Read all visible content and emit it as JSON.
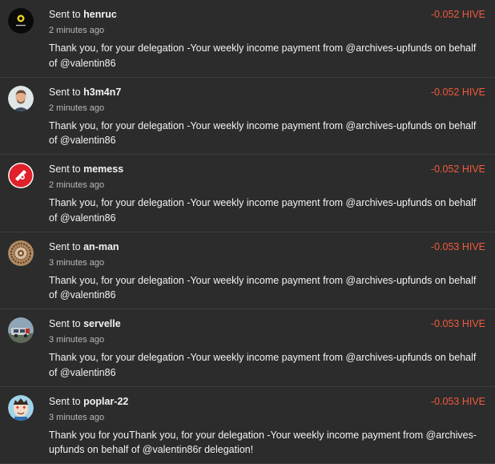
{
  "sent_prefix": "Sent to",
  "transactions": [
    {
      "user": "henruc",
      "time": "2 minutes ago",
      "amount": "-0.052 HIVE",
      "memo": "Thank you, for your delegation -Your weekly income payment from @archives-upfunds on behalf of @valentin86",
      "avatar": "black-circle-yellow-logo-avatar"
    },
    {
      "user": "h3m4n7",
      "time": "2 minutes ago",
      "amount": "-0.052 HIVE",
      "memo": "Thank you, for your delegation -Your weekly income payment from @archives-upfunds on behalf of @valentin86",
      "avatar": "man-portrait-avatar"
    },
    {
      "user": "memess",
      "time": "2 minutes ago",
      "amount": "-0.052 HIVE",
      "memo": "Thank you, for your delegation -Your weekly income payment from @archives-upfunds on behalf of @valentin86",
      "avatar": "red-circle-logo-avatar"
    },
    {
      "user": "an-man",
      "time": "3 minutes ago",
      "amount": "-0.053 HIVE",
      "memo": "Thank you, for your delegation -Your weekly income payment from @archives-upfunds on behalf of @valentin86",
      "avatar": "ornate-mandala-avatar"
    },
    {
      "user": "servelle",
      "time": "3 minutes ago",
      "amount": "-0.053 HIVE",
      "memo": "Thank you, for your delegation -Your weekly income payment from @archives-upfunds on behalf of @valentin86",
      "avatar": "vehicle-photo-avatar"
    },
    {
      "user": "poplar-22",
      "time": "3 minutes ago",
      "amount": "-0.053 HIVE",
      "memo": "Thank you for youThank you, for your delegation -Your weekly income payment from @archives-upfunds on behalf of @valentin86r delegation!",
      "avatar": "cartoon-character-avatar"
    }
  ],
  "colors": {
    "background": "#2c2c2c",
    "amount": "#ef5a3c",
    "divider": "#3d3d3d"
  }
}
